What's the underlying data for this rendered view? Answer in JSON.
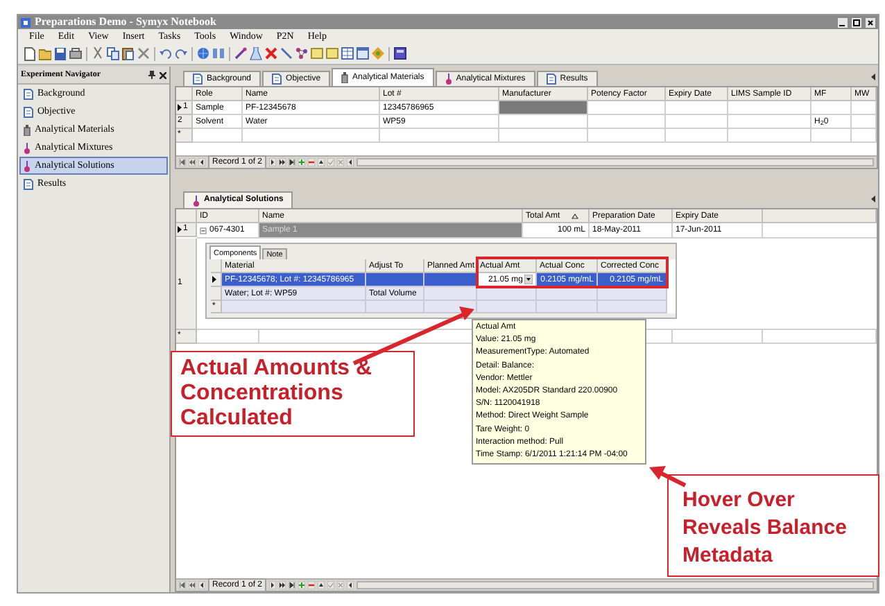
{
  "window": {
    "title": "Preparations Demo - Symyx Notebook"
  },
  "menu": [
    "File",
    "Edit",
    "View",
    "Insert",
    "Tasks",
    "Tools",
    "Window",
    "P2N",
    "Help"
  ],
  "navigator": {
    "title": "Experiment Navigator",
    "items": [
      {
        "label": "Background",
        "kind": "page",
        "selected": false
      },
      {
        "label": "Objective",
        "kind": "page",
        "selected": false
      },
      {
        "label": "Analytical Materials",
        "kind": "bottle",
        "selected": false
      },
      {
        "label": "Analytical Mixtures",
        "kind": "flask",
        "selected": false
      },
      {
        "label": "Analytical Solutions",
        "kind": "flask",
        "selected": true
      },
      {
        "label": "Results",
        "kind": "page",
        "selected": false
      }
    ]
  },
  "tabs": [
    {
      "label": "Background",
      "kind": "page",
      "selected": false
    },
    {
      "label": "Objective",
      "kind": "page",
      "selected": false
    },
    {
      "label": "Analytical Materials",
      "kind": "bottle",
      "selected": true
    },
    {
      "label": "Analytical Mixtures",
      "kind": "flask",
      "selected": false
    },
    {
      "label": "Results",
      "kind": "page",
      "selected": false
    }
  ],
  "materials_grid": {
    "columns": [
      "Role",
      "Name",
      "Lot #",
      "Manufacturer",
      "Potency Factor",
      "Expiry Date",
      "LIMS Sample ID",
      "MF",
      "MW"
    ],
    "rows": [
      {
        "header": "1",
        "current": true,
        "cells": [
          {
            "text": "Sample",
            "shaded": false
          },
          {
            "text": "PF-12345678",
            "shaded": false
          },
          {
            "text": "12345786965",
            "shaded": false
          },
          {
            "shaded": true
          },
          {
            "shaded": false
          },
          {
            "shaded": false
          },
          {
            "shaded": false
          },
          {
            "shaded": false
          },
          {
            "shaded": false
          }
        ]
      },
      {
        "header": "2",
        "current": false,
        "cells": [
          {
            "text": "Solvent",
            "shaded": false
          },
          {
            "text": "Water",
            "shaded": false
          },
          {
            "text": "WP59",
            "shaded": false
          },
          {
            "shaded": false
          },
          {
            "shaded": false
          },
          {
            "shaded": false
          },
          {
            "shaded": false
          },
          {
            "text": "H$_{2}$0",
            "shaded": false
          },
          {
            "shaded": false
          }
        ]
      },
      {
        "header": "*",
        "current": false,
        "cells": [
          {
            "shaded": false
          },
          {
            "shaded": false
          },
          {
            "shaded": false
          },
          {
            "shaded": false
          },
          {
            "shaded": false
          },
          {
            "shaded": false
          },
          {
            "shaded": false
          },
          {
            "shaded": false
          },
          {
            "shaded": false
          }
        ]
      }
    ],
    "record": "Record 1 of 2"
  },
  "solutions": {
    "tab": "Analytical Solutions",
    "columns": [
      "ID",
      "Name",
      "Total Amt",
      "Preparation Date",
      "Expiry Date"
    ],
    "row": {
      "header": "1",
      "current": true,
      "expanded": true,
      "cells": [
        "067-4301",
        "Sample 1",
        "100 mL",
        "18-May-2011",
        "17-Jun-2011"
      ]
    },
    "detail_header": "1",
    "new_row_header": "*",
    "components": {
      "tabs": [
        {
          "label": "Components",
          "selected": true
        },
        {
          "label": "Note",
          "selected": false
        }
      ],
      "columns": [
        "Material",
        "Adjust To",
        "Planned Amt",
        "Actual Amt",
        "Actual Conc",
        "Corrected Conc"
      ],
      "rows": [
        {
          "current": true,
          "selected": true,
          "cells": [
            "PF-12345678; Lot #: 12345786965",
            "",
            "",
            "21.05 mg",
            "0.2105 mg/mL",
            "0.2105 mg/mL"
          ]
        },
        {
          "current": false,
          "selected": false,
          "cells": [
            "Water; Lot #: WP59",
            "Total Volume",
            "",
            "",
            "",
            ""
          ]
        }
      ],
      "new_row_header": "*"
    },
    "record": "Record 1 of 2"
  },
  "tooltip": [
    "Actual Amt",
    "Value: 21.05 mg",
    "MeasurementType: Automated",
    "Detail: Balance:",
    "Vendor: Mettler",
    "Model: AX205DR Standard 220.00900",
    "S/N: 1120041918",
    "Method: Direct Weight Sample",
    "Tare Weight: 0",
    "Interaction method: Pull",
    "Time Stamp: 6/1/2011 1:21:14 PM -04:00"
  ],
  "callouts": [
    {
      "lines": [
        "Actual Amounts &",
        "Concentrations",
        "Calculated"
      ]
    },
    {
      "lines": [
        "Hover Over",
        "Reveals Balance",
        "Metadata"
      ]
    }
  ]
}
